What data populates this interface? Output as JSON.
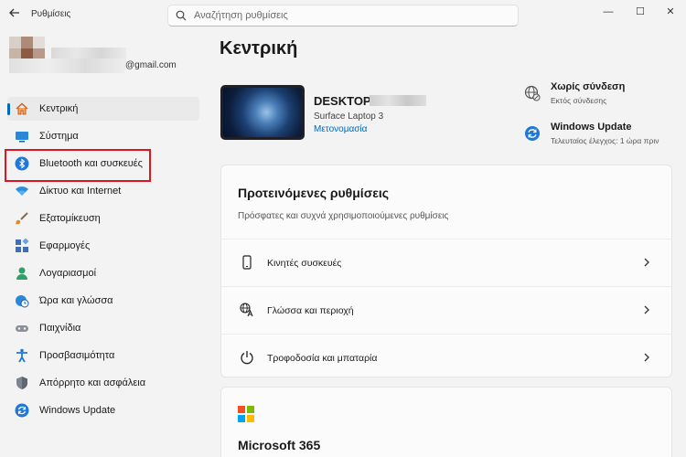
{
  "window": {
    "app_title": "Ρυθμίσεις",
    "search_placeholder": "Αναζήτηση ρυθμίσεις",
    "controls": [
      "—",
      "☐",
      "✕"
    ]
  },
  "account": {
    "email": "@gmail.com"
  },
  "sidebar": {
    "items": [
      {
        "label": "Κεντρική",
        "icon": "home-icon",
        "active": true
      },
      {
        "label": "Σύστημα",
        "icon": "system-icon"
      },
      {
        "label": "Bluetooth και συσκευές",
        "icon": "bluetooth-icon",
        "highlighted": true
      },
      {
        "label": "Δίκτυο και Internet",
        "icon": "wifi-icon"
      },
      {
        "label": "Εξατομίκευση",
        "icon": "brush-icon"
      },
      {
        "label": "Εφαρμογές",
        "icon": "apps-icon"
      },
      {
        "label": "Λογαριασμοί",
        "icon": "person-icon"
      },
      {
        "label": "Ώρα και γλώσσα",
        "icon": "globe-clock-icon"
      },
      {
        "label": "Παιχνίδια",
        "icon": "gamepad-icon"
      },
      {
        "label": "Προσβασιμότητα",
        "icon": "accessibility-icon"
      },
      {
        "label": "Απόρρητο και ασφάλεια",
        "icon": "shield-icon"
      },
      {
        "label": "Windows Update",
        "icon": "update-icon"
      }
    ]
  },
  "main": {
    "page_title": "Κεντρική",
    "device": {
      "name": "DESKTOP-",
      "model": "Surface Laptop 3",
      "rename_link": "Μετονομασία"
    },
    "status": [
      {
        "title": "Χωρίς σύνδεση",
        "subtitle": "Εκτός σύνδεσης",
        "icon": "globe-offline-icon"
      },
      {
        "title": "Windows Update",
        "subtitle": "Τελευταίος έλεγχος: 1 ώρα πριν",
        "icon": "update-icon"
      }
    ],
    "recommended": {
      "title": "Προτεινόμενες ρυθμίσεις",
      "subtitle": "Πρόσφατες και συχνά χρησιμοποιούμενες ρυθμίσεις",
      "rows": [
        {
          "label": "Κινητές συσκευές",
          "icon": "phone-icon"
        },
        {
          "label": "Γλώσσα και περιοχή",
          "icon": "language-icon"
        },
        {
          "label": "Τροφοδοσία και μπαταρία",
          "icon": "power-icon"
        }
      ]
    },
    "ms365": {
      "title": "Microsoft 365"
    }
  },
  "colors": {
    "accent": "#0067c0",
    "highlight_box": "#e0141e"
  }
}
